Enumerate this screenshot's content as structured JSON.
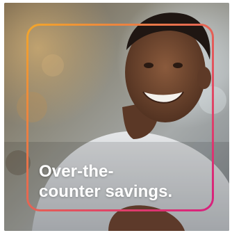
{
  "promo": {
    "headline_line1": "Over-the-",
    "headline_line2": "counter savings."
  },
  "colors": {
    "frame_gradient_start": "#f2a62b",
    "frame_gradient_end": "#d81f7e",
    "headline_text": "#ffffff"
  }
}
